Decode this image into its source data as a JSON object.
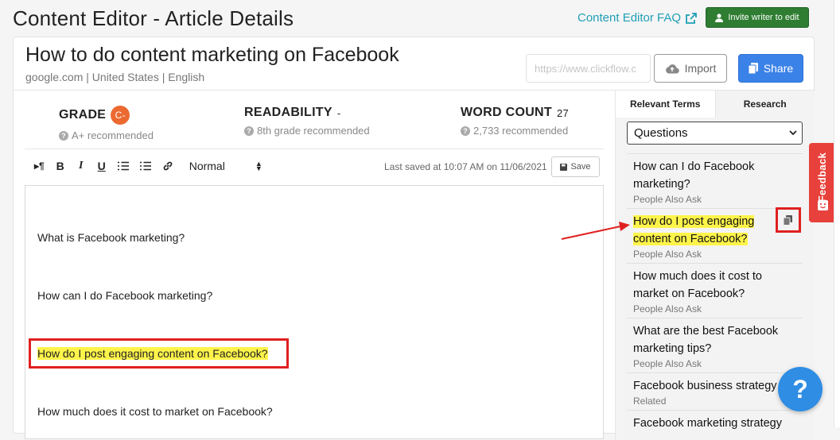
{
  "header": {
    "title": "Content Editor - Article Details",
    "faq_label": "Content Editor FAQ",
    "invite_label": "Invite writer to edit"
  },
  "article": {
    "title": "How to do content marketing on Facebook",
    "meta": "google.com | United States | English",
    "url_placeholder": "https://www.clickflow.c",
    "import_label": "Import",
    "share_label": "Share"
  },
  "stats": {
    "grade_label": "GRADE",
    "grade_value": "C-",
    "grade_rec": "A+ recommended",
    "readability_label": "READABILITY",
    "readability_value": "-",
    "readability_rec": "8th grade recommended",
    "wordcount_label": "WORD COUNT",
    "wordcount_value": "27",
    "wordcount_rec": "2,733 recommended"
  },
  "toolbar": {
    "format_select": "Normal",
    "saved_text": "Last saved at 10:07 AM on 11/06/2021",
    "save_label": "Save"
  },
  "editor": {
    "lines": [
      "What is Facebook marketing?",
      "How can I do Facebook marketing?",
      "How do I post engaging content on Facebook?",
      "How much does it cost to market on Facebook?"
    ]
  },
  "right_panel": {
    "tabs": [
      "Relevant Terms",
      "Research"
    ],
    "filter_selected": "Questions",
    "items": [
      {
        "text": "How can I do Facebook marketing?",
        "source": "People Also Ask"
      },
      {
        "text": "How do I post engaging content on Facebook?",
        "source": "People Also Ask"
      },
      {
        "text": "How much does it cost to market on Facebook?",
        "source": "People Also Ask"
      },
      {
        "text": "What are the best Facebook marketing tips?",
        "source": "People Also Ask"
      },
      {
        "text": "Facebook business strategy",
        "source": "Related"
      },
      {
        "text": "Facebook marketing strategy",
        "source": ""
      }
    ]
  },
  "widgets": {
    "feedback_label": "Feedback",
    "help_label": "?"
  },
  "colors": {
    "accent_blue": "#3b82e8",
    "invite_green": "#2e7d32",
    "highlight_yellow": "#fff44a",
    "annotation_red": "#e02020",
    "grade_orange": "#ec6a32"
  }
}
